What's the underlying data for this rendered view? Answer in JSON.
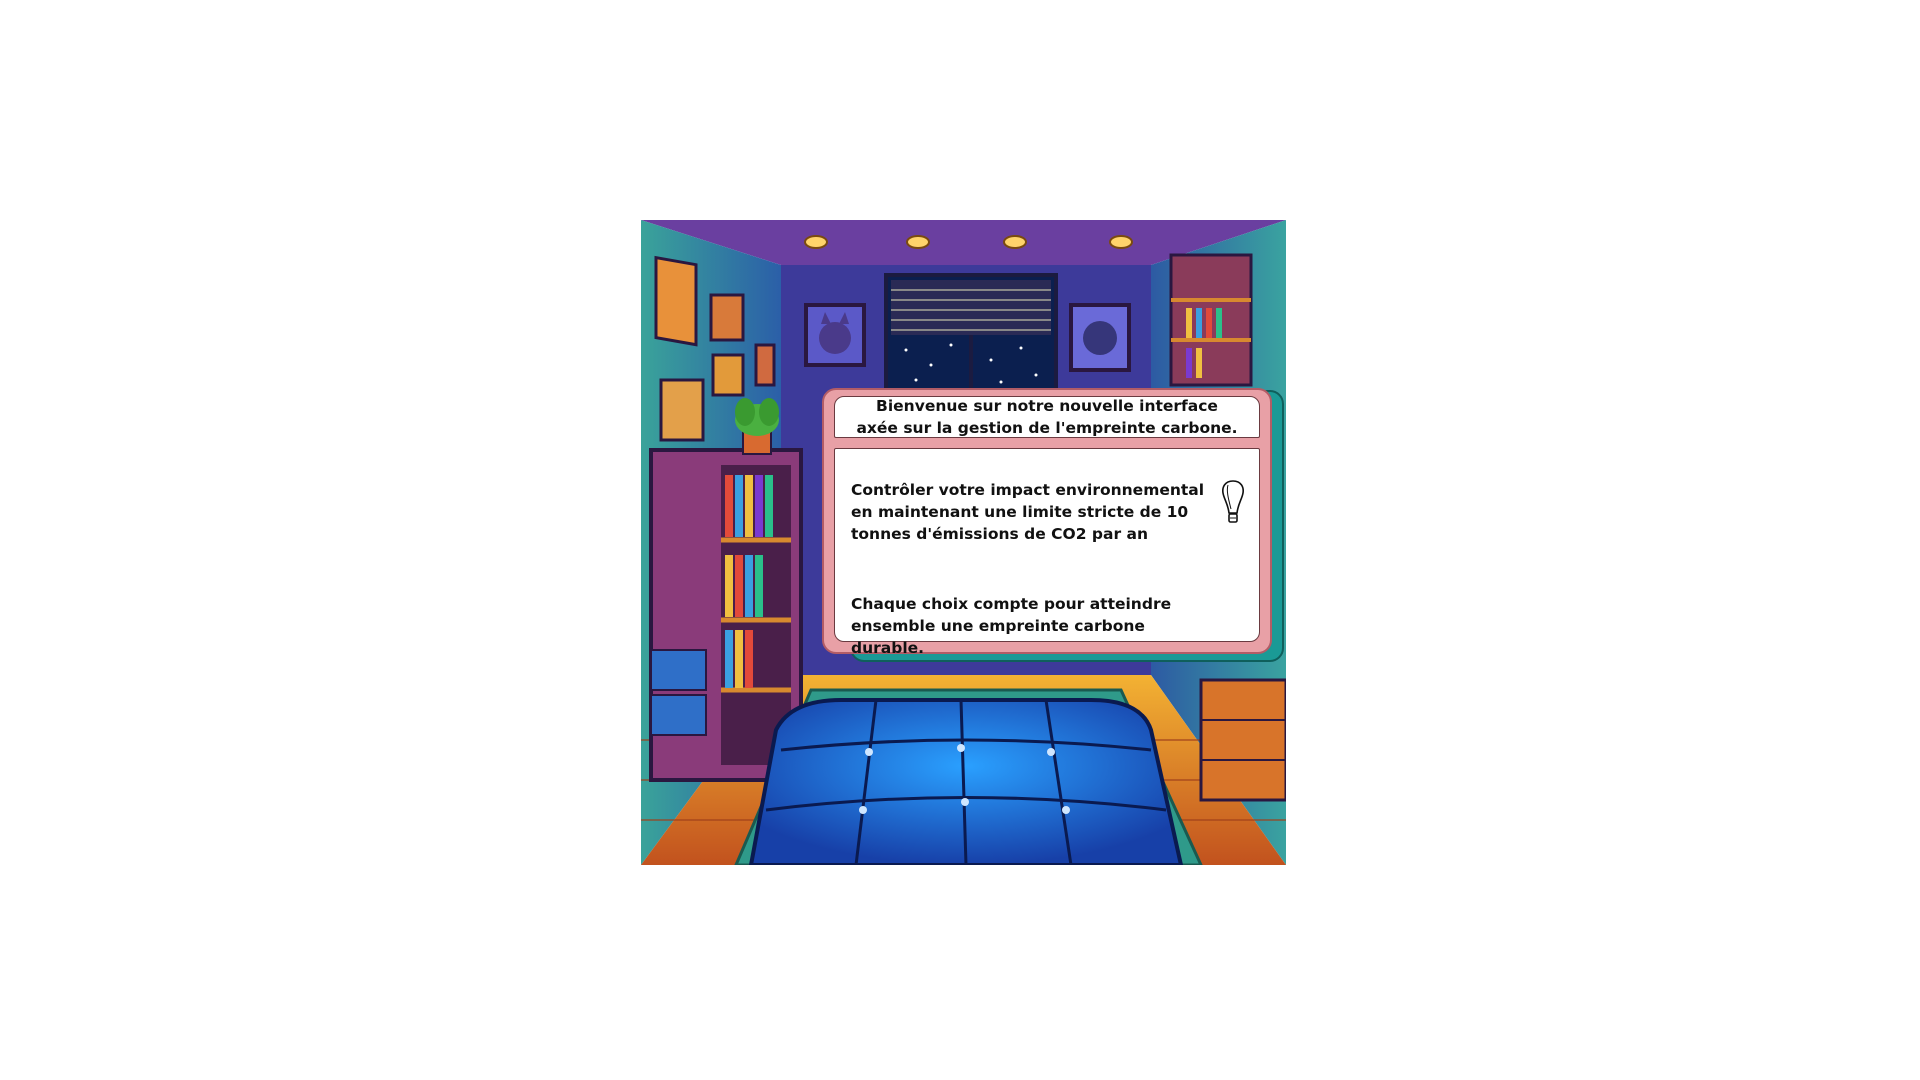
{
  "scene": {
    "setting": "bedroom-night",
    "icons": [
      "cat-poster-icon",
      "bear-poster-icon",
      "window-icon",
      "bookshelf-icon",
      "plant-icon",
      "bed-icon"
    ]
  },
  "dialog": {
    "title_line1": "Bienvenue sur notre nouvelle interface",
    "title_line2": "axée sur la gestion de l'empreinte carbone.",
    "message1": "Contrôler votre impact environnemental en maintenant une limite stricte de 10 tonnes d'émissions de CO2 par an",
    "message2": "Chaque choix compte pour atteindre ensemble une empreinte carbone durable.",
    "icon": "lightbulb-icon"
  },
  "colors": {
    "dialog_fill": "#e8a0a6",
    "dialog_shadow": "#1a9a96",
    "text": "#111111"
  }
}
